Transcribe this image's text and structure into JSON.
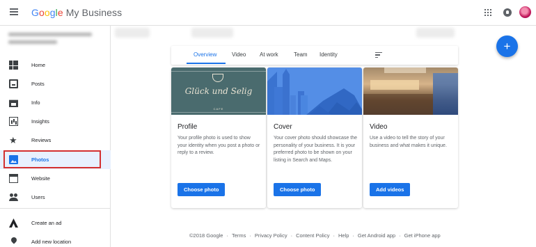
{
  "app": {
    "brand_letters": [
      "G",
      "o",
      "o",
      "g",
      "l",
      "e"
    ],
    "product": "My Business"
  },
  "sidebar": {
    "items": [
      {
        "label": "Home",
        "icon": "dashboard-icon"
      },
      {
        "label": "Posts",
        "icon": "posts-icon"
      },
      {
        "label": "Info",
        "icon": "storefront-icon"
      },
      {
        "label": "Insights",
        "icon": "insights-icon"
      },
      {
        "label": "Reviews",
        "icon": "star-icon"
      },
      {
        "label": "Photos",
        "icon": "photos-icon",
        "active": true
      },
      {
        "label": "Website",
        "icon": "website-icon"
      },
      {
        "label": "Users",
        "icon": "users-icon"
      },
      {
        "label": "Create an ad",
        "icon": "google-ads-icon"
      },
      {
        "label": "Add new location",
        "icon": "location-pin-icon"
      }
    ]
  },
  "tabs": {
    "items": [
      "Overview",
      "Video",
      "At work",
      "Team",
      "Identity"
    ],
    "active": "Overview"
  },
  "cards": [
    {
      "title": "Profile",
      "desc": "Your profile photo is used to show your identity when you post a photo or reply to a review.",
      "button": "Choose photo",
      "image_text": {
        "script": "Glück und Selig",
        "small": "CAFE"
      }
    },
    {
      "title": "Cover",
      "desc": "Your cover photo should showcase the personality of your business. It is your preferred photo to be shown on your listing in Search and Maps.",
      "button": "Choose photo"
    },
    {
      "title": "Video",
      "desc": "Use a video to tell the story of your business and what makes it unique.",
      "button": "Add videos"
    }
  ],
  "footer": {
    "links": [
      "©2018 Google",
      "Terms",
      "Privacy Policy",
      "Content Policy",
      "Help",
      "Get Android app",
      "Get iPhone app"
    ]
  },
  "colors": {
    "accent": "#1a73e8",
    "highlight_box": "#d32f2f"
  }
}
